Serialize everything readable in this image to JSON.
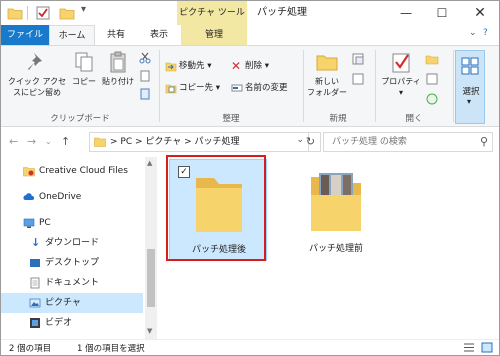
{
  "window": {
    "title": "パッチ処理",
    "context_tab": "ピクチャ ツール",
    "minimize_glyph": "—",
    "maximize_glyph": "☐",
    "close_glyph": "✕"
  },
  "tabs": {
    "file": "ファイル",
    "home": "ホーム",
    "share": "共有",
    "view": "表示",
    "manage": "管理"
  },
  "ribbon": {
    "pin_quick_access": [
      "クイック アクセ",
      "スにピン留め"
    ],
    "copy": "コピー",
    "paste": "貼り付け",
    "clipboard_group": "クリップボード",
    "move_to": "移動先",
    "copy_to": "コピー先",
    "delete": "削除",
    "rename": "名前の変更",
    "organize_group": "整理",
    "new_folder": [
      "新しい",
      "フォルダー"
    ],
    "new_group": "新規",
    "properties": "プロパティ",
    "open_group": "開く",
    "select": "選択"
  },
  "address": {
    "path": "> PC > ピクチャ > パッチ処理",
    "search_placeholder": "パッチ処理 の検索"
  },
  "nav_pane": {
    "items": [
      {
        "label": "Creative Cloud Files"
      },
      {
        "label": "OneDrive"
      },
      {
        "label": "PC"
      },
      {
        "label": "ダウンロード"
      },
      {
        "label": "デスクトップ"
      },
      {
        "label": "ドキュメント"
      },
      {
        "label": "ピクチャ"
      },
      {
        "label": "ビデオ"
      }
    ]
  },
  "files": [
    {
      "name": "パッチ処理後",
      "selected": true
    },
    {
      "name": "パッチ処理前",
      "selected": false
    }
  ],
  "status": {
    "item_count": "2 個の項目",
    "selected_count": "1 個の項目を選択"
  },
  "colors": {
    "accent": "#1979ca",
    "context_tab": "#f3e8a3",
    "selection": "#cce8ff",
    "highlight_box": "#d71e1e",
    "folder": "#f6d36b"
  }
}
